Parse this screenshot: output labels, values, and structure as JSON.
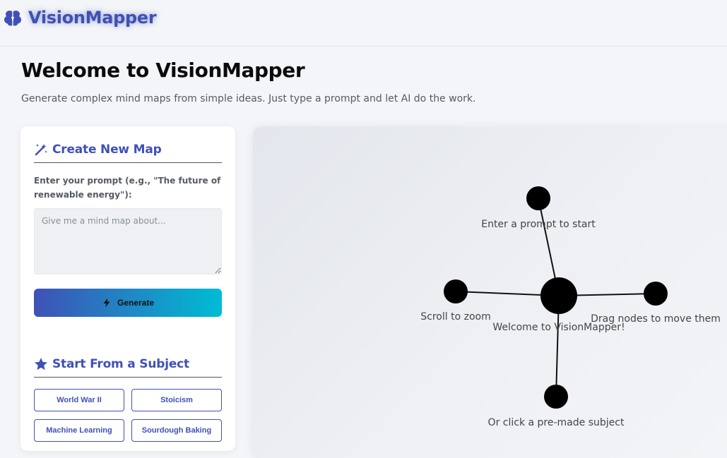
{
  "header": {
    "brand_name": "VisionMapper",
    "brand_icon": "brain-icon",
    "accent_color": "#3f51b5"
  },
  "page": {
    "title": "Welcome to VisionMapper",
    "subtitle": "Generate complex mind maps from simple ideas. Just type a prompt and let AI do the work."
  },
  "create_panel": {
    "heading": "Create New Map",
    "heading_icon": "magic-wand-icon",
    "prompt_label": "Enter your prompt (e.g., \"The future of renewable energy\"):",
    "prompt_value": "",
    "prompt_placeholder": "Give me a mind map about...",
    "generate_label": "Generate",
    "generate_icon": "bolt-icon",
    "gradient": [
      "#3f51b5",
      "#00bcd4"
    ]
  },
  "subjects_panel": {
    "heading": "Start From a Subject",
    "heading_icon": "star-icon",
    "subjects": [
      "World War II",
      "Stoicism",
      "Machine Learning",
      "Sourdough Baking"
    ]
  },
  "mind_map": {
    "center": {
      "label": "Welcome to VisionMapper!"
    },
    "branches": [
      {
        "label": "Enter a prompt to start"
      },
      {
        "label": "Scroll to zoom"
      },
      {
        "label": "Drag nodes to move them"
      },
      {
        "label": "Or click a pre-made subject"
      }
    ]
  }
}
